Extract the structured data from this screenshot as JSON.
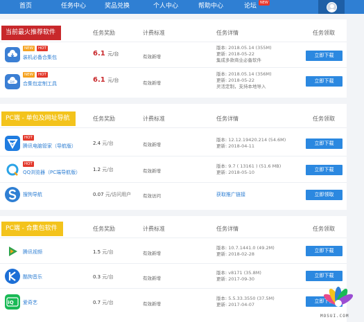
{
  "nav": {
    "items": [
      "首页",
      "任务中心",
      "奖品兑换",
      "个人中心",
      "帮助中心",
      "论坛"
    ],
    "new_badge": "NEW"
  },
  "columns": [
    "任务奖励",
    "计费标准",
    "任务详情",
    "任务领取"
  ],
  "sections": [
    {
      "title": "当前最火推荐软件",
      "title_color": "#c8282b",
      "rows": [
        {
          "icon": "cloud-download-icon",
          "icon_color": "#3b7fd4",
          "tags": [
            "NEW",
            "HOT"
          ],
          "name": "装机必备合集包",
          "reward": "6.1",
          "unit": "元/台",
          "standard": "有效新增",
          "detail": [
            "版本: 2018.05.14 (355M)",
            "更新: 2018-05-22",
            "集成多款商业必备软件"
          ],
          "button": "立即下载"
        },
        {
          "icon": "diy-cloud-icon",
          "icon_color": "#3b7fd4",
          "tags": [
            "NEW",
            "HOT"
          ],
          "name": "合集包定制工具",
          "reward": "6.1",
          "unit": "元/台",
          "standard": "有效新增",
          "detail": [
            "版本: 2018.05.14 (356M)",
            "更新: 2018-05-22",
            "灵活定制，支持本地导入"
          ],
          "button": "立即下载"
        }
      ]
    },
    {
      "title": "PC端 - 单包及网址导航",
      "title_color": "#f3c31c",
      "rows": [
        {
          "icon": "tencent-pc-manager-icon",
          "icon_color": "#1f7ce0",
          "tags": [
            "HOT"
          ],
          "name": "腾讯电脑管家（导航版）",
          "reward": "2.4",
          "unit": "元/台",
          "standard": "有效新增",
          "detail": [
            "版本: 12.12.19420.214 (54.6M)",
            "更新: 2018-04-11"
          ],
          "button": "立即下载"
        },
        {
          "icon": "qq-browser-icon",
          "icon_color": "#2aa3e6",
          "tags": [
            "HOT"
          ],
          "name": "QQ浏览器（PC端导航版）",
          "reward": "1.2",
          "unit": "元/台",
          "standard": "有效新增",
          "detail": [
            "版本: 9.7 ( 13161 ) (51.6 MB)",
            "更新: 2018-05-10"
          ],
          "button": "立即下载"
        },
        {
          "icon": "sogou-nav-icon",
          "icon_color": "#2f7fd3",
          "tags": [],
          "name": "搜狗导航",
          "reward": "0.07",
          "unit": "元/访问用户",
          "standard": "有效访问",
          "detail_link": "获取推广链接",
          "button": "立即领取"
        }
      ]
    },
    {
      "title": "PC端 - 合集包软件",
      "title_color": "#f3c31c",
      "rows": [
        {
          "icon": "tencent-video-icon",
          "icon_color": "#2fa34b",
          "tags": [],
          "name": "腾讯视频",
          "reward": "1.5",
          "unit": "元/台",
          "standard": "有效新增",
          "detail": [
            "版本: 10.7.1441.0 (49.2M)",
            "更新: 2018-02-28"
          ],
          "button": "立即下载"
        },
        {
          "icon": "kugou-music-icon",
          "icon_color": "#1d6fd6",
          "tags": [],
          "name": "酷狗音乐",
          "reward": "0.3",
          "unit": "元/台",
          "standard": "有效新增",
          "detail": [
            "版本: v8171 (35.8M)",
            "更新: 2017-09-30"
          ],
          "button": "立即下载"
        },
        {
          "icon": "iqiyi-icon",
          "icon_color": "#19b955",
          "tags": [],
          "name": "爱奇艺",
          "reward": "0.7",
          "unit": "元/台",
          "standard": "有效新增",
          "detail": [
            "版本: 5.5.33.3550 (37.5M)",
            "更新: 2017-04-07"
          ],
          "button": "立即下载"
        }
      ]
    }
  ],
  "watermark": "MOSUI.COM"
}
